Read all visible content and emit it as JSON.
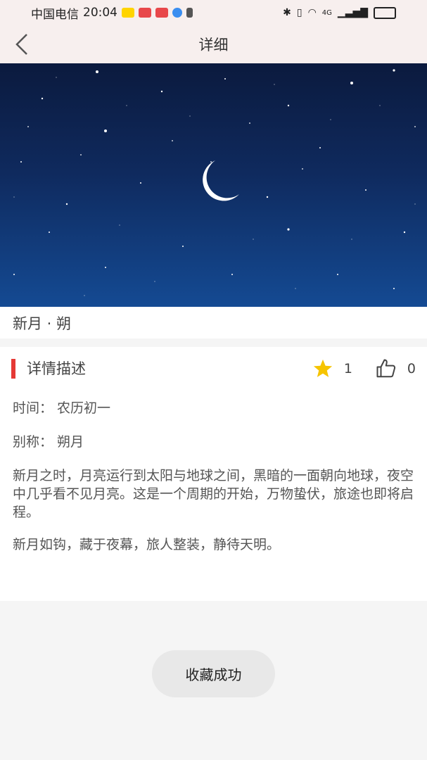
{
  "status_bar": {
    "carrier": "中国电信",
    "time": "20:04",
    "network": "4G"
  },
  "nav": {
    "title": "详细"
  },
  "item": {
    "name": "新月 · 朔"
  },
  "detail": {
    "section_title": "详情描述",
    "favorite_count": "1",
    "like_count": "0",
    "time_line": "时间：  农历初一",
    "alias_line": "别称：  朔月",
    "description": "新月之时，月亮运行到太阳与地球之间，黑暗的一面朝向地球，夜空中几乎看不见月亮。这是一个周期的开始，万物蛰伏，旅途也即将启程。",
    "verse": "新月如钩，藏于夜幕，旅人整装，静待天明。"
  },
  "toast": {
    "text": "收藏成功"
  },
  "colors": {
    "accent_bar": "#e53935",
    "star": "#f6c400",
    "header_bg": "#f7efee"
  }
}
